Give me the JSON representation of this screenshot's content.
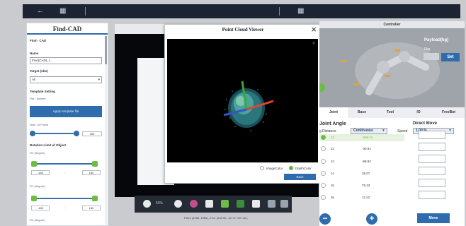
{
  "topbar": {
    "back_icon": "arrow-left-icon",
    "doc_icon": "document-icon",
    "grid_icon": "grid-icon"
  },
  "left_panel": {
    "title": "Find-CAD",
    "section": "Find - CAD",
    "name_label": "Name",
    "name_value": "Find(CAD)_1",
    "target_label": "Target (obs)",
    "target_value": "All",
    "template_setting": "Template Setting",
    "file_label": "File : Sphere",
    "apply_button": "Apply template file",
    "num_points_label": "Num. of Points",
    "num_points_value": "400",
    "rotation_label": "Rotation Limit of Object",
    "rx_label": "RX (degree)",
    "rx_min": "-180",
    "rx_sep": "~",
    "rx_max": "180",
    "ry_label": "RY (degree)",
    "ry_min": "-180",
    "ry_sep": "~",
    "ry_max": "180",
    "rz_label": "RZ (degree)"
  },
  "point_cloud_viewer": {
    "title": "Point Cloud Viewer",
    "close": "×",
    "note": "⑤",
    "option_image_color": "ImageColor",
    "option_depth_color": "DepthColor",
    "selected": "DepthColor",
    "button": "Back"
  },
  "bottom_toolbar": {
    "zoom": "50%"
  },
  "status": "Pixel: (6786, 1969), XYZ: (202.90, -32.37, 997.42);",
  "controller": {
    "title": "Controller",
    "payload_label": "Payload(kg)",
    "payload_value": "0kg",
    "set_button": "Set",
    "tabs": [
      "Joint",
      "Base",
      "Tool",
      "IO",
      "FreeBot"
    ],
    "active_tab": "Joint",
    "moving_label": "g Distance",
    "moving_mode": "Continuous",
    "speed_label": "Speed",
    "speed_value": "1.00 %",
    "joint_angle_title": "Joint Angle",
    "direct_move_title": "Direct Move",
    "joints": [
      {
        "name": "J1",
        "value": "-206.74",
        "selected": true
      },
      {
        "name": "J2",
        "value": "-30.91",
        "selected": false
      },
      {
        "name": "J3",
        "value": "-99.92",
        "selected": false
      },
      {
        "name": "J4",
        "value": "35.07",
        "selected": false
      },
      {
        "name": "J5",
        "value": "75.33",
        "selected": false
      },
      {
        "name": "J6",
        "value": "12.42",
        "selected": false
      }
    ],
    "minus_button": "−",
    "plus_button": "+",
    "move_button": "Move"
  },
  "colors": {
    "accent": "#2f6cad",
    "selected": "#6cbd45",
    "dark": "#1c2431"
  }
}
